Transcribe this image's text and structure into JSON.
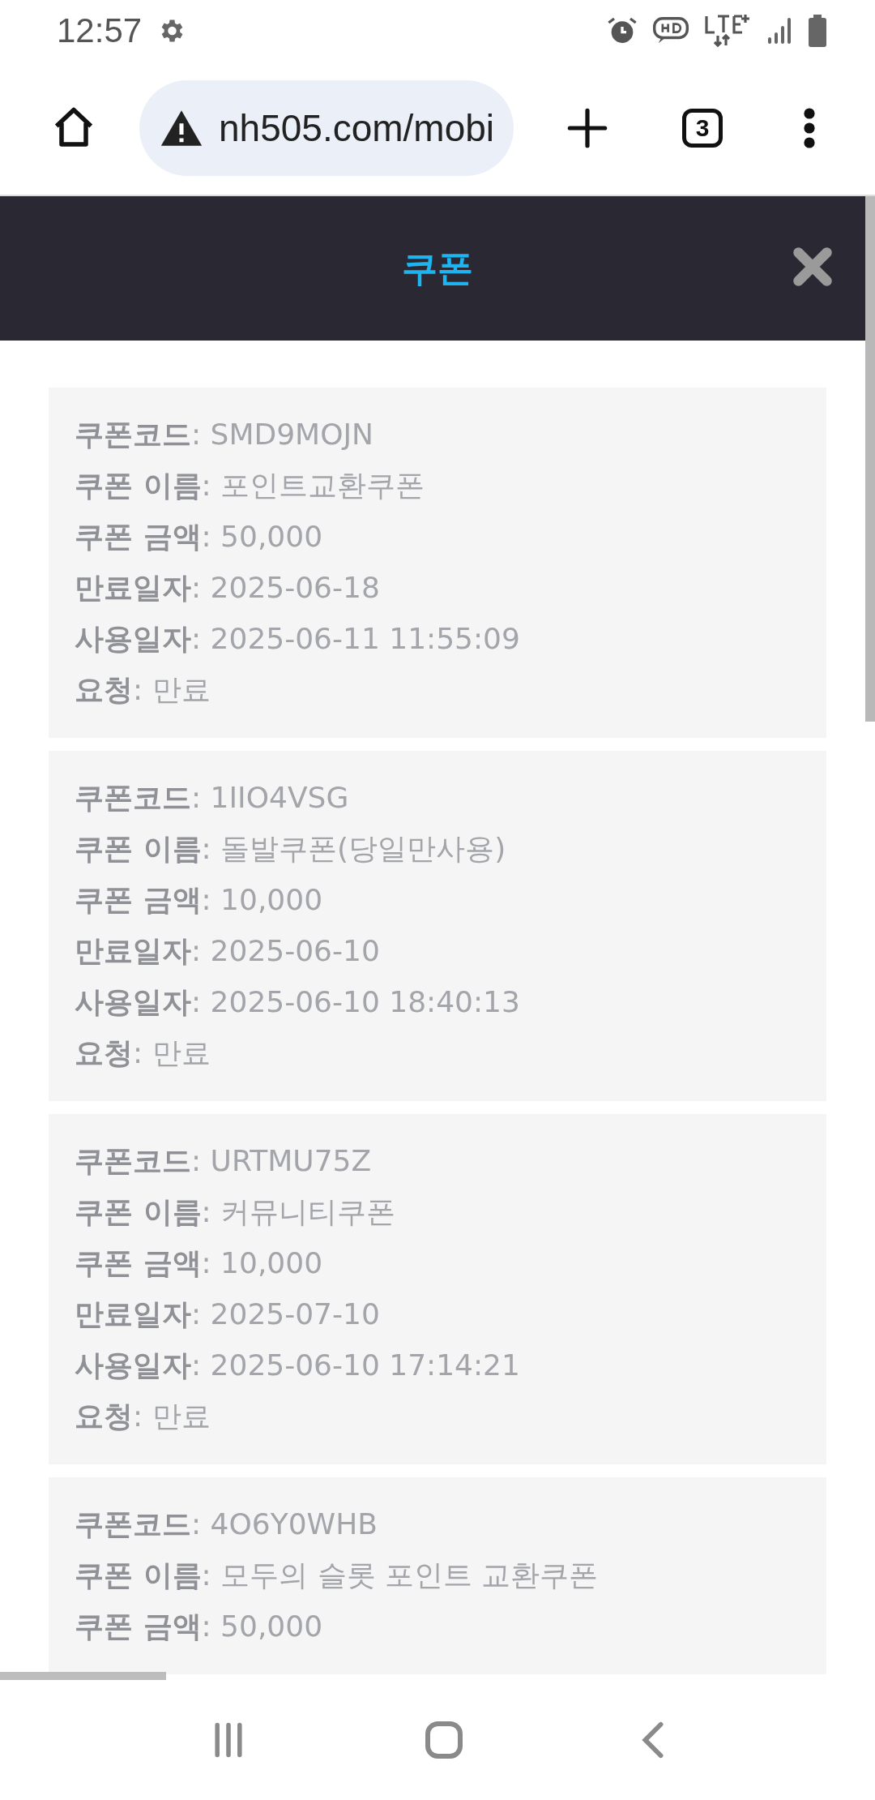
{
  "status_bar": {
    "time": "12:57"
  },
  "browser": {
    "url": "nh505.com/mobi",
    "tab_count": "3"
  },
  "header": {
    "title": "쿠폰"
  },
  "coupons": [
    {
      "lines": [
        "**쿠폰코드**: SMD9MOJN",
        "**쿠폰 이름**: 포인트교환쿠폰",
        "**쿠폰 금액**: 50,000",
        "**만료일자**: 2025-06-18",
        "**사용일자**: 2025-06-11 11:55:09",
        "**요청**: 만료"
      ]
    },
    {
      "lines": [
        "**쿠폰코드**: 1IIO4VSG",
        "**쿠폰 이름**: 돌발쿠폰(당일만사용)",
        "**쿠폰 금액**: 10,000",
        "**만료일자**: 2025-06-10",
        "**사용일자**: 2025-06-10 18:40:13",
        "**요청**: 만료"
      ]
    },
    {
      "lines": [
        "**쿠폰코드**: URTMU75Z",
        "**쿠폰 이름**: 커뮤니티쿠폰",
        "**쿠폰 금액**: 10,000",
        "**만료일자**: 2025-07-10",
        "**사용일자**: 2025-06-10 17:14:21",
        "**요청**: 만료"
      ]
    },
    {
      "lines": [
        "**쿠폰코드**: 4O6Y0WHB",
        "**쿠폰 이름**: 모두의 슬롯 포인트 교환쿠폰",
        "**쿠폰 금액**: 50,000"
      ]
    }
  ]
}
